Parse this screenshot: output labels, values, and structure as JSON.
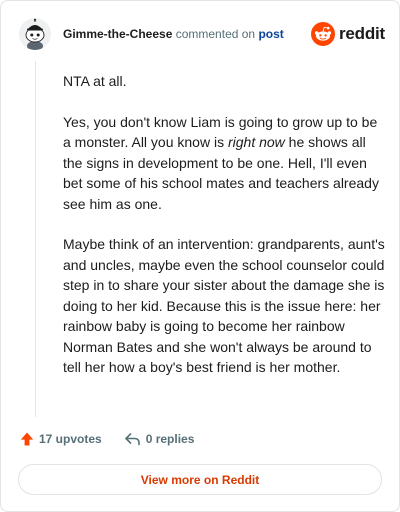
{
  "header": {
    "username": "Gimme-the-Cheese",
    "action_text": "commented on",
    "post_link": "post",
    "brand": "reddit"
  },
  "comment": {
    "paragraphs": [
      {
        "text": "NTA at all."
      },
      {
        "before": "Yes, you don't know Liam is going to grow up to be a monster. All you know is ",
        "emphasis": "right now",
        "after": " he shows all the signs in development to be one. Hell, I'll even bet some of his school mates and teachers already see him as one."
      },
      {
        "text": "Maybe think of an intervention: grandparents, aunt's and uncles, maybe even the school counselor could step in to share your sister about the damage she is doing to her kid. Because this is the issue here: her rainbow baby is going to become her rainbow Norman Bates and she won't always be around to tell her how a boy's best friend is her mother."
      }
    ]
  },
  "actions": {
    "upvotes": "17 upvotes",
    "replies": "0 replies"
  },
  "footer": {
    "view_button": "View more on Reddit"
  },
  "colors": {
    "brand_orange": "#ff4500",
    "button_text": "#d93a00",
    "link_blue": "#0a449b"
  },
  "icons": {
    "avatar": "snoo-avatar",
    "brand": "reddit-snoo-icon",
    "upvote": "upvote-arrow-icon",
    "reply": "reply-arrow-icon"
  }
}
